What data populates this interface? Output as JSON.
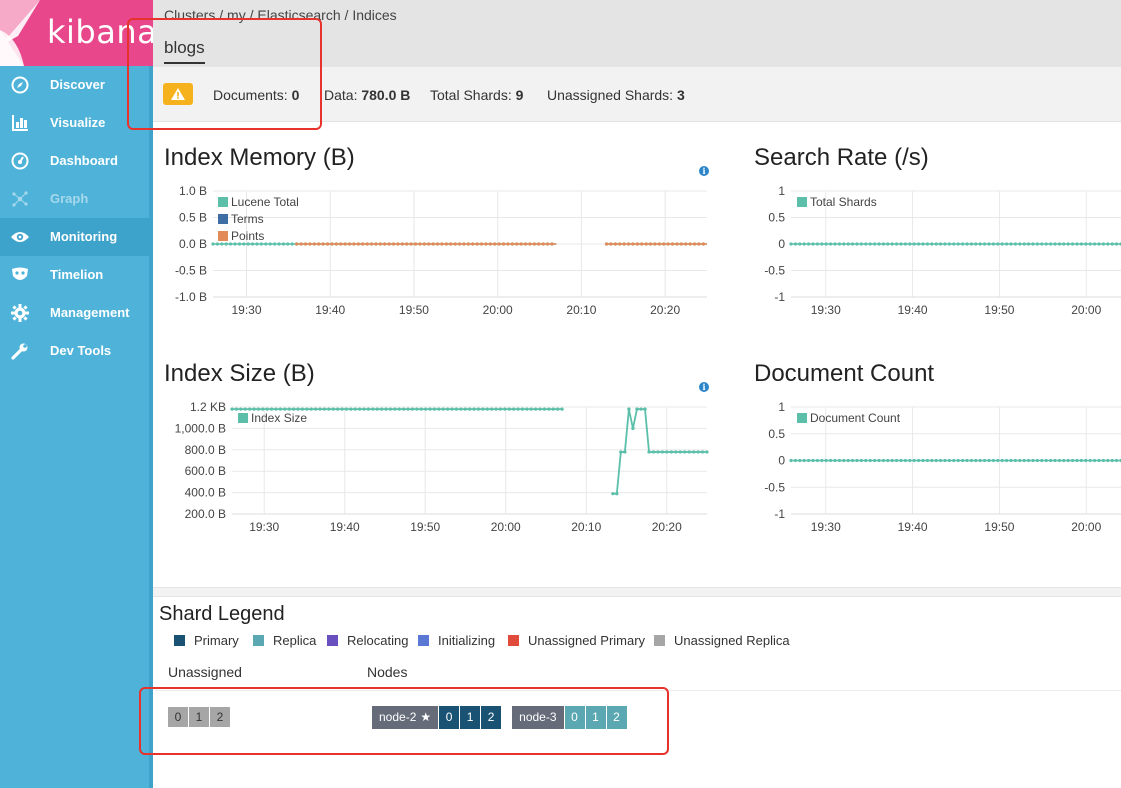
{
  "app": {
    "name": "kibana"
  },
  "sidebar": {
    "items": [
      {
        "label": "Discover",
        "icon": "compass-icon"
      },
      {
        "label": "Visualize",
        "icon": "bar-chart-icon"
      },
      {
        "label": "Dashboard",
        "icon": "dashboard-gauge-icon"
      },
      {
        "label": "Graph",
        "icon": "graph-network-icon",
        "disabled": true
      },
      {
        "label": "Monitoring",
        "icon": "eye-icon",
        "active": true
      },
      {
        "label": "Timelion",
        "icon": "timelion-mask-icon"
      },
      {
        "label": "Management",
        "icon": "gear-icon"
      },
      {
        "label": "Dev Tools",
        "icon": "wrench-icon"
      }
    ]
  },
  "header": {
    "breadcrumbs": [
      "Clusters",
      "my",
      "Elasticsearch",
      "Indices"
    ],
    "title": "blogs"
  },
  "stats": {
    "documents_label": "Documents:",
    "documents": "0",
    "data_label": "Data:",
    "data": "780.0 B",
    "total_shards_label": "Total Shards:",
    "total_shards": "9",
    "unassigned_label": "Unassigned Shards:",
    "unassigned": "3"
  },
  "colors": {
    "accent": "#4fb3d9",
    "brand": "#e8488b",
    "teal": "#5bbfaa",
    "orange": "#e38a59",
    "warning": "#f5b21c"
  },
  "chart_data": [
    {
      "type": "line",
      "title": "Index Memory (B)",
      "yticks": [
        "1.0 B",
        "0.5 B",
        "0.0 B",
        "-0.5 B",
        "-1.0 B"
      ],
      "ylim": [
        -1,
        1
      ],
      "xticks": [
        "19:30",
        "19:40",
        "19:50",
        "20:00",
        "20:10",
        "20:20"
      ],
      "x_range": [
        "19:26",
        "20:25"
      ],
      "legend": [
        "Lucene Total",
        "Terms",
        "Points"
      ],
      "legend_colors": [
        "#5bbfaa",
        "#3f6ea5",
        "#e38a59"
      ],
      "series": [
        {
          "name": "Lucene Total",
          "segments": [
            {
              "from": "19:26",
              "to": "19:36",
              "value": 0
            },
            {
              "from": "19:36",
              "to": "20:07",
              "value": 0
            },
            {
              "from": "20:13",
              "to": "20:25",
              "value": 0
            }
          ]
        },
        {
          "name": "Points",
          "segments": [
            {
              "from": "19:36",
              "to": "20:07",
              "value": 0
            },
            {
              "from": "20:13",
              "to": "20:25",
              "value": 0
            }
          ]
        }
      ]
    },
    {
      "type": "line",
      "title": "Search Rate (/s)",
      "yticks": [
        "1",
        "0.5",
        "0",
        "-0.5",
        "-1"
      ],
      "ylim": [
        -1,
        1
      ],
      "xticks": [
        "19:30",
        "19:40",
        "19:50",
        "20:00"
      ],
      "x_range": [
        "19:26",
        "20:04"
      ],
      "legend": [
        "Total Shards"
      ],
      "legend_colors": [
        "#5bbfaa"
      ],
      "series": [
        {
          "name": "Total Shards",
          "segments": [
            {
              "from": "19:26",
              "to": "20:04",
              "value": 0
            }
          ]
        }
      ]
    },
    {
      "type": "line",
      "title": "Index Size (B)",
      "yticks": [
        "1.2 KB",
        "1,000.0 B",
        "800.0 B",
        "600.0 B",
        "400.0 B",
        "200.0 B"
      ],
      "ylim": [
        200,
        1200
      ],
      "xticks": [
        "19:30",
        "19:40",
        "19:50",
        "20:00",
        "20:10",
        "20:20"
      ],
      "x_range": [
        "19:26",
        "20:25"
      ],
      "legend": [
        "Index Size"
      ],
      "legend_colors": [
        "#5bbfaa"
      ],
      "series": [
        {
          "name": "Index Size",
          "points": [
            [
              "19:26",
              1180
            ],
            [
              "20:07",
              1180
            ],
            [
              "20:13.3",
              390
            ],
            [
              "20:13.8",
              390
            ],
            [
              "20:14.3",
              780
            ],
            [
              "20:14.8",
              780
            ],
            [
              "20:15.3",
              1180
            ],
            [
              "20:15.8",
              1000
            ],
            [
              "20:16.3",
              1180
            ],
            [
              "20:17.3",
              1180
            ],
            [
              "20:17.8",
              780
            ],
            [
              "20:25",
              780
            ]
          ],
          "gap_after_index": 1
        }
      ]
    },
    {
      "type": "line",
      "title": "Document Count",
      "yticks": [
        "1",
        "0.5",
        "0",
        "-0.5",
        "-1"
      ],
      "ylim": [
        -1,
        1
      ],
      "xticks": [
        "19:30",
        "19:40",
        "19:50",
        "20:00"
      ],
      "x_range": [
        "19:26",
        "20:04"
      ],
      "legend": [
        "Document Count"
      ],
      "legend_colors": [
        "#5bbfaa"
      ],
      "series": [
        {
          "name": "Document Count",
          "segments": [
            {
              "from": "19:26",
              "to": "20:04",
              "value": 0
            }
          ]
        }
      ]
    }
  ],
  "shard_legend": {
    "title": "Shard Legend",
    "items": [
      {
        "label": "Primary",
        "color": "#1a5273"
      },
      {
        "label": "Replica",
        "color": "#5ba8b3"
      },
      {
        "label": "Relocating",
        "color": "#6a4fbf"
      },
      {
        "label": "Initializing",
        "color": "#5a78d4"
      },
      {
        "label": "Unassigned Primary",
        "color": "#e04b3b"
      },
      {
        "label": "Unassigned Replica",
        "color": "#a6a6a6"
      }
    ],
    "unassigned_header": "Unassigned",
    "nodes_header": "Nodes",
    "unassigned_shards": [
      "0",
      "1",
      "2"
    ],
    "nodes": [
      {
        "name": "node-2",
        "master": true,
        "shards": [
          "0",
          "1",
          "2"
        ],
        "kind": "primary"
      },
      {
        "name": "node-3",
        "master": false,
        "shards": [
          "0",
          "1",
          "2"
        ],
        "kind": "replica"
      }
    ]
  }
}
